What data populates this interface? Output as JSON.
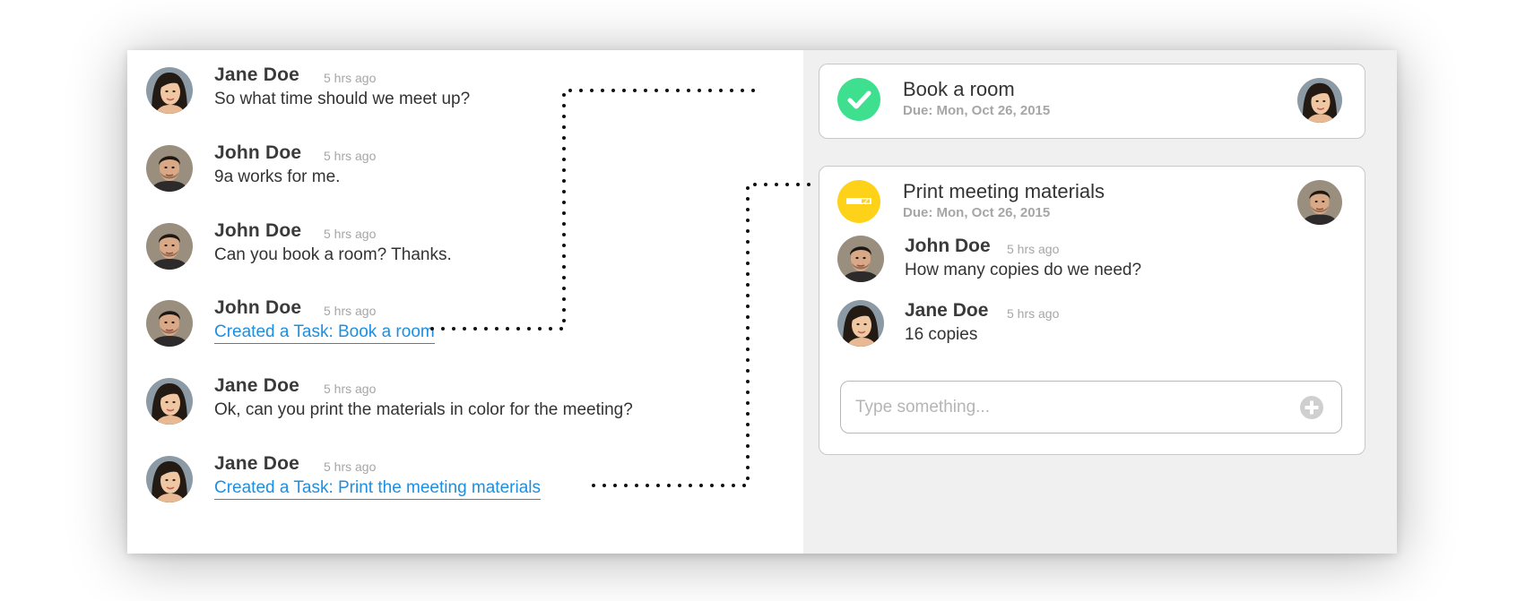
{
  "chat": {
    "messages": [
      {
        "author": "Jane Doe",
        "time": "5 hrs ago",
        "text": "So what time should we meet up?",
        "is_link": false,
        "avatar": "jane-avatar"
      },
      {
        "author": "John Doe",
        "time": "5 hrs ago",
        "text": "9a works for me.",
        "is_link": false,
        "avatar": "john-avatar"
      },
      {
        "author": "John Doe",
        "time": "5 hrs ago",
        "text": "Can you book a room? Thanks.",
        "is_link": false,
        "avatar": "john-avatar"
      },
      {
        "author": "John Doe",
        "time": "5 hrs ago",
        "text": "Created a Task: Book a room",
        "is_link": true,
        "avatar": "john-avatar"
      },
      {
        "author": "Jane Doe",
        "time": "5 hrs ago",
        "text": "Ok, can you print the materials in color for the meeting?",
        "is_link": false,
        "avatar": "jane-avatar"
      },
      {
        "author": "Jane Doe",
        "time": "5 hrs ago",
        "text": "Created a Task: Print the meeting materials",
        "is_link": true,
        "avatar": "jane-avatar"
      }
    ]
  },
  "tasks": [
    {
      "title": "Book a room",
      "due": "Due: Mon, Oct 26, 2015",
      "status": "complete",
      "status_icon": "checkmark-icon",
      "status_color": "#3ee08f",
      "assignee_avatar": "jane-avatar"
    },
    {
      "title": "Print meeting materials",
      "due": "Due: Mon, Oct 26, 2015",
      "status": "in-progress",
      "status_icon": "progress-bar-icon",
      "status_color": "#ffd21a",
      "assignee_avatar": "john-avatar",
      "comments": [
        {
          "author": "John Doe",
          "time": "5 hrs ago",
          "text": "How many copies do we need?",
          "avatar": "john-avatar"
        },
        {
          "author": "Jane Doe",
          "time": "5 hrs ago",
          "text": "16 copies",
          "avatar": "jane-avatar"
        }
      ],
      "comment_placeholder": "Type something..."
    }
  ],
  "colors": {
    "link": "#1e8fe0",
    "task_pane_bg": "#f0f0f0",
    "complete": "#3ee08f",
    "in_progress": "#ffd21a"
  }
}
